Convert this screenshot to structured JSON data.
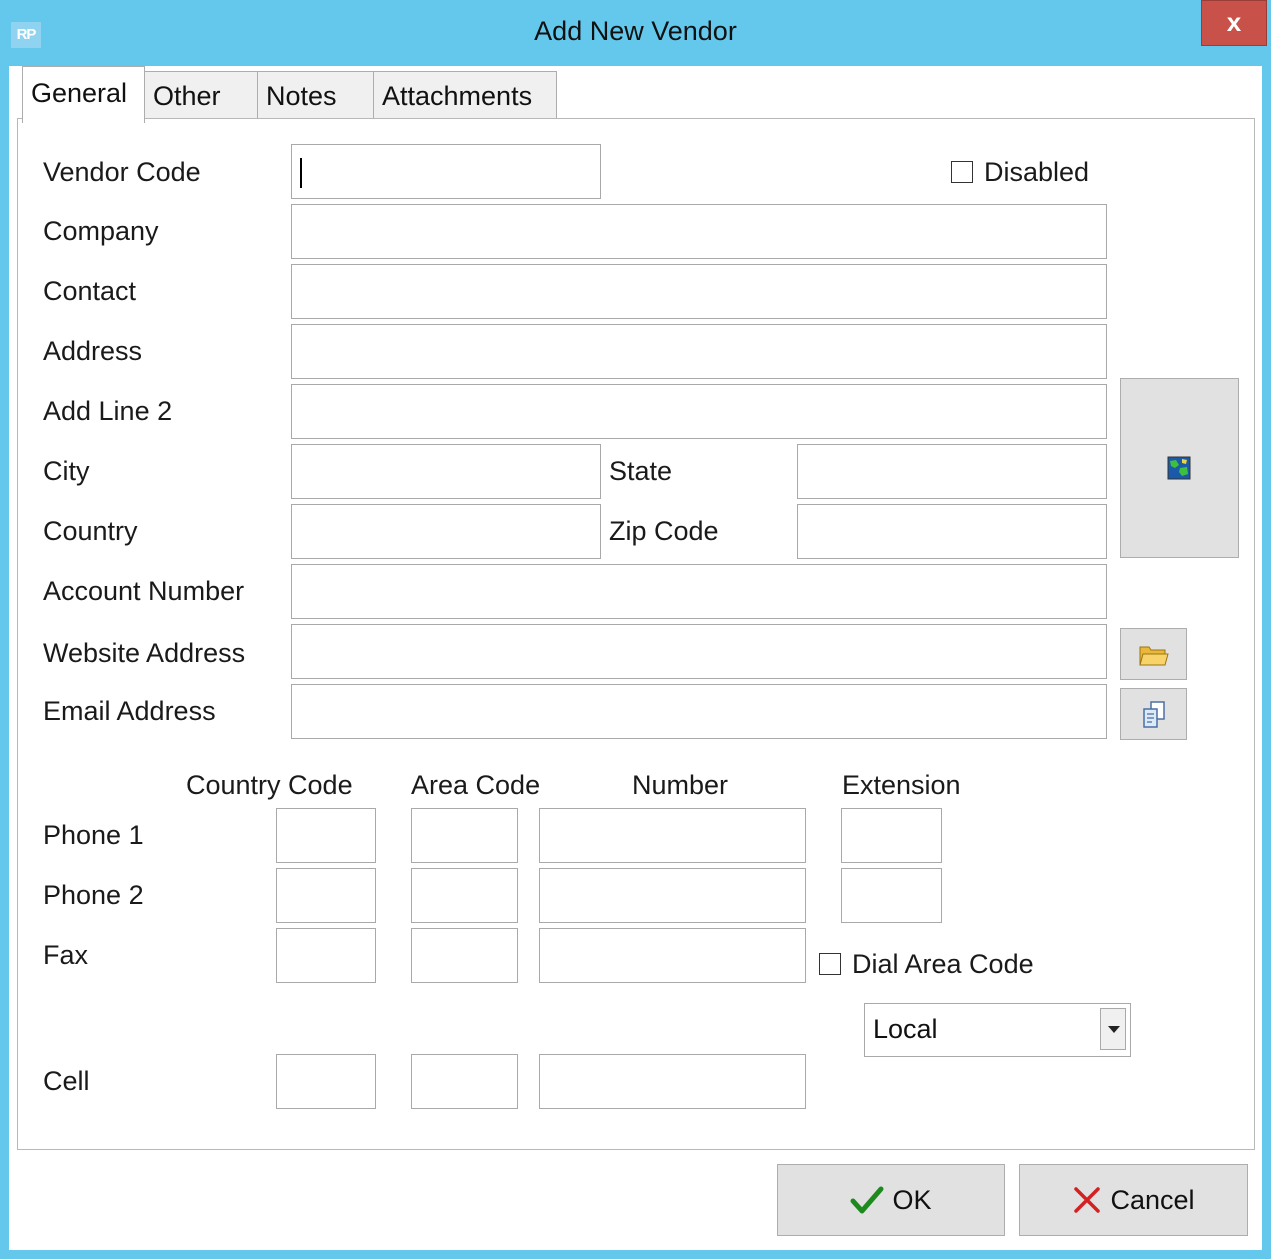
{
  "window": {
    "app_icon_text": "RP",
    "title": "Add New Vendor",
    "close_label": "x"
  },
  "tabs": [
    {
      "label": "General"
    },
    {
      "label": "Other"
    },
    {
      "label": "Notes"
    },
    {
      "label": "Attachments"
    }
  ],
  "form": {
    "vendor_code_label": "Vendor Code",
    "disabled_label": "Disabled",
    "company_label": "Company",
    "contact_label": "Contact",
    "address_label": "Address",
    "add_line2_label": "Add Line 2",
    "city_label": "City",
    "state_label": "State",
    "country_label": "Country",
    "zip_label": "Zip Code",
    "account_label": "Account Number",
    "website_label": "Website Address",
    "email_label": "Email Address"
  },
  "phone": {
    "country_code_header": "Country Code",
    "area_code_header": "Area Code",
    "number_header": "Number",
    "extension_header": "Extension",
    "phone1_label": "Phone 1",
    "phone2_label": "Phone 2",
    "fax_label": "Fax",
    "cell_label": "Cell",
    "dial_area_code_label": "Dial Area Code",
    "dial_mode_value": "Local"
  },
  "buttons": {
    "ok": "OK",
    "cancel": "Cancel"
  },
  "colors": {
    "titlebar": "#63c8eb",
    "close": "#c8514a",
    "ok_check": "#1e8a1e",
    "cancel_x": "#d42020"
  }
}
